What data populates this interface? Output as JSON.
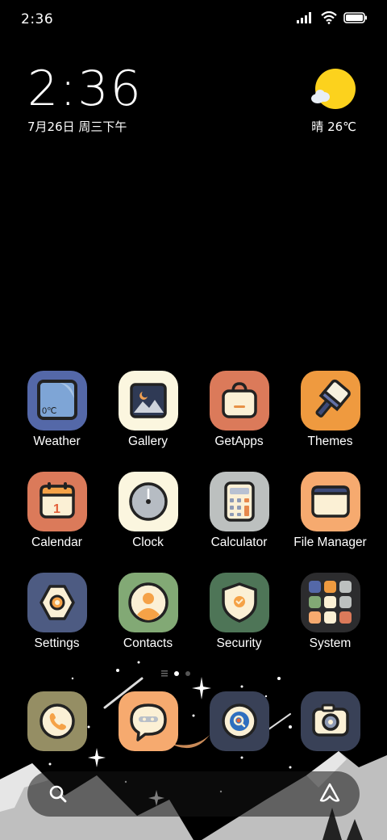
{
  "status_bar": {
    "time": "2:36"
  },
  "clock_widget": {
    "time": "2:36",
    "date": "7月26日 周三下午"
  },
  "weather_widget": {
    "text": "晴 26℃"
  },
  "weather_icon_label": "0℃",
  "calendar_day": "1",
  "apps": [
    {
      "label": "Weather"
    },
    {
      "label": "Gallery"
    },
    {
      "label": "GetApps"
    },
    {
      "label": "Themes"
    },
    {
      "label": "Calendar"
    },
    {
      "label": "Clock"
    },
    {
      "label": "Calculator"
    },
    {
      "label": "File Manager"
    },
    {
      "label": "Settings"
    },
    {
      "label": "Contacts"
    },
    {
      "label": "Security"
    },
    {
      "label": "System"
    }
  ],
  "dock": {
    "items": [
      "phone-icon",
      "messages-icon",
      "browser-icon",
      "camera-icon"
    ]
  },
  "colors": {
    "weather": "#5468a8",
    "gallery": "#fbf6df",
    "getapps": "#db7a5a",
    "themes": "#ef9a3f",
    "calendar": "#db7a5a",
    "clock": "#fbf6df",
    "calculator": "#bcc0bf",
    "file_manager": "#f6aa6f",
    "settings": "#4d5b82",
    "contacts": "#82a975",
    "security": "#4e7557",
    "system": "#2c2c2e",
    "phone": "#958e64",
    "messages": "#f6aa6f",
    "browser": "#394157",
    "camera": "#394157"
  }
}
